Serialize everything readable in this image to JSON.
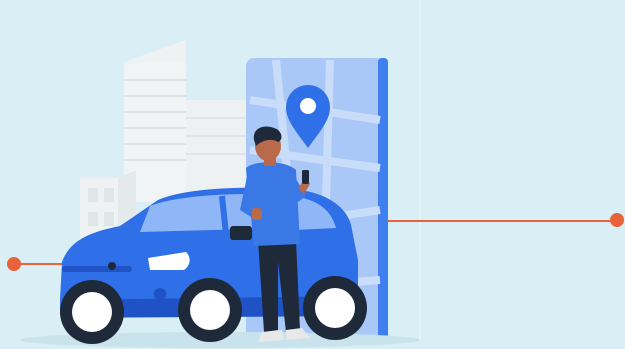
{
  "illustration": {
    "subject": "person-with-car-and-map-pin",
    "icons": [
      "location-pin-icon",
      "smartphone-icon"
    ],
    "colors": {
      "background": "#d9eef5",
      "accent_orange": "#e8623a",
      "car_blue": "#2f6fe8",
      "car_blue_dark": "#1f52c4",
      "map_blue": "#a9c8f7",
      "pin_blue": "#2f6fe8",
      "building_gray": "#eef2f3",
      "shirt_blue": "#3a78e6",
      "pants_dark": "#1e2a3a",
      "skin": "#b86a4a"
    }
  }
}
